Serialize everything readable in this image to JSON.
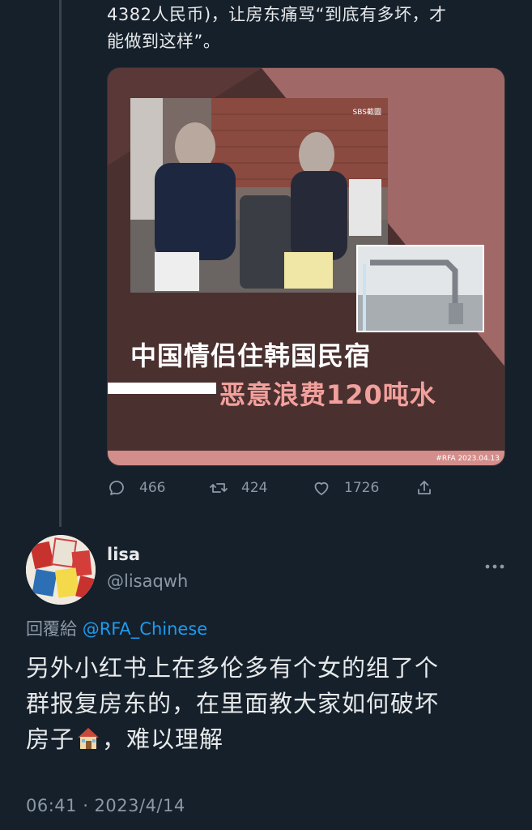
{
  "previous_tweet": {
    "text_lines": [
      "4382人民币)，让房东痛骂“到底有多坏，才",
      "能做到这样”。"
    ],
    "media": {
      "photo_credit": "SBS截圖",
      "headline_line1": "中国情侣住韩国民宿",
      "headline_line2": "恶意浪费120吨水",
      "source_tag": "#RFA  2023.04.13"
    },
    "actions": {
      "reply_count": "466",
      "retweet_count": "424",
      "like_count": "1726"
    }
  },
  "reply_tweet": {
    "author_name": "lisa",
    "author_handle": "@lisaqwh",
    "reply_prefix": "回覆給 ",
    "reply_to": "@RFA_Chinese",
    "body_line1": "另外小红书上在多伦多有个女的组了个",
    "body_line2": "群报复房东的，在里面教大家如何破坏",
    "body_line3_start": "房子",
    "body_line3_end": "，难以理解",
    "timestamp": "06:41 · 2023/4/14"
  },
  "icons": {
    "reply": "comment-icon",
    "retweet": "retweet-icon",
    "like": "heart-icon",
    "share": "share-icon",
    "more": "more-icon",
    "emoji": "house-emoji-icon"
  },
  "colors": {
    "background": "#15202b",
    "text": "#e7e9ea",
    "muted": "#8b98a5",
    "link": "#1d9bf0",
    "card_dark": "#4b3030",
    "card_accent": "#d38d8a",
    "headline_pink": "#f2a09c"
  }
}
